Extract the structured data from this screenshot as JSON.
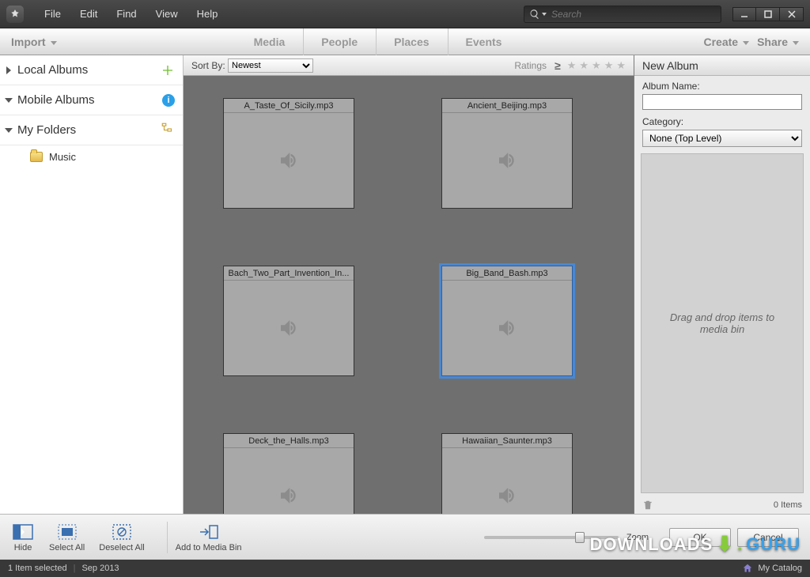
{
  "menu": {
    "file": "File",
    "edit": "Edit",
    "find": "Find",
    "view": "View",
    "help": "Help"
  },
  "search": {
    "placeholder": "Search"
  },
  "tabbar": {
    "import": "Import",
    "tabs": [
      "Media",
      "People",
      "Places",
      "Events"
    ],
    "create": "Create",
    "share": "Share"
  },
  "sidebar": {
    "local": "Local Albums",
    "mobile": "Mobile Albums",
    "folders": "My Folders",
    "music": "Music"
  },
  "gridbar": {
    "sortby": "Sort By:",
    "sort_options": [
      "Newest"
    ],
    "ratings": "Ratings"
  },
  "thumbs": [
    {
      "name": "A_Taste_Of_Sicily.mp3",
      "selected": false
    },
    {
      "name": "Ancient_Beijing.mp3",
      "selected": false
    },
    {
      "name": "Bach_Two_Part_Invention_In...",
      "selected": false
    },
    {
      "name": "Big_Band_Bash.mp3",
      "selected": true
    },
    {
      "name": "Deck_the_Halls.mp3",
      "selected": false
    },
    {
      "name": "Hawaiian_Saunter.mp3",
      "selected": false
    }
  ],
  "rpanel": {
    "title": "New Album",
    "album_name_label": "Album Name:",
    "album_name_value": "",
    "category_label": "Category:",
    "category_value": "None (Top Level)",
    "bin_hint": "Drag and drop items to media bin",
    "items_count": "0 Items"
  },
  "bottom": {
    "hide": "Hide",
    "select_all": "Select All",
    "deselect_all": "Deselect All",
    "add_bin": "Add to Media Bin",
    "zoom": "Zoom",
    "ok": "OK",
    "cancel": "Cancel"
  },
  "status": {
    "selected": "1 Item selected",
    "date": "Sep 2013",
    "catalog": "My Catalog"
  },
  "watermark": {
    "a": "DOWNLOADS",
    "b": "GURU"
  }
}
